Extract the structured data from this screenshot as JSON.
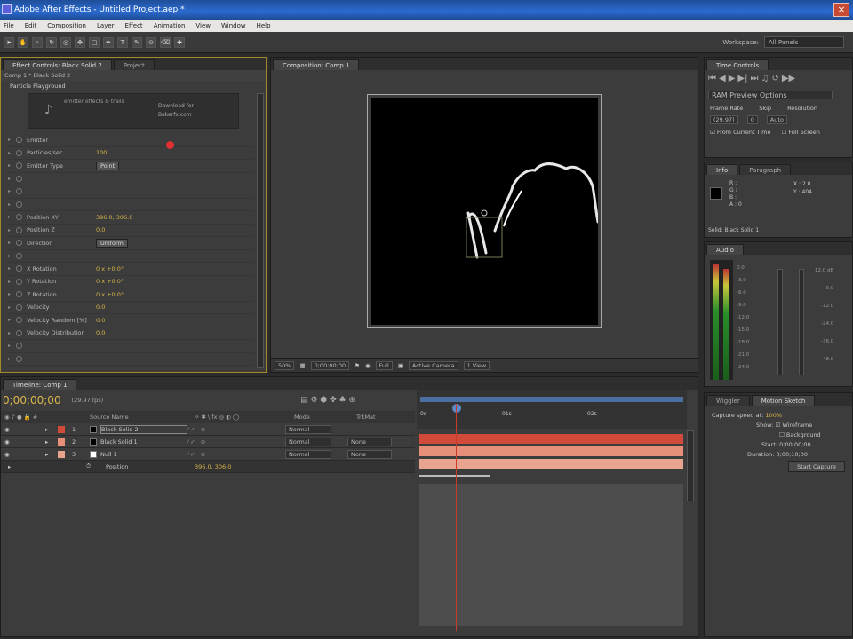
{
  "title": "Adobe After Effects - Untitled Project.aep *",
  "menu": [
    "File",
    "Edit",
    "Composition",
    "Layer",
    "Effect",
    "Animation",
    "View",
    "Window",
    "Help"
  ],
  "workspace": {
    "label": "Workspace:",
    "value": "All Panels"
  },
  "effect_panel": {
    "tabs": [
      "Effect Controls: Black Solid 2",
      "Project"
    ],
    "breadcrumb": "Comp 1 * Black Solid 2",
    "effect_name": "Particle Playground",
    "about_text": [
      "emitter effects & trails",
      "Download for",
      "Bakerfx.com"
    ],
    "rows": [
      {
        "label": "Emitter",
        "value": ""
      },
      {
        "label": "Particles/sec",
        "value": "100"
      },
      {
        "label": "Emitter Type",
        "value": "Point",
        "dropdown": true
      },
      {
        "label": "",
        "value": ""
      },
      {
        "label": "",
        "value": ""
      },
      {
        "label": "",
        "value": ""
      },
      {
        "label": "Position XY",
        "value": "396.0, 306.0"
      },
      {
        "label": "Position Z",
        "value": "0.0"
      },
      {
        "label": "Direction",
        "value": "Uniform",
        "dropdown": true
      },
      {
        "label": "",
        "value": ""
      },
      {
        "label": "X Rotation",
        "value": "0 x +0.0°"
      },
      {
        "label": "Y Rotation",
        "value": "0 x +0.0°"
      },
      {
        "label": "Z Rotation",
        "value": "0 x +0.0°"
      },
      {
        "label": "Velocity",
        "value": "0.0"
      },
      {
        "label": "Velocity Random [%]",
        "value": "0.0"
      },
      {
        "label": "Velocity Distribution",
        "value": "0.0"
      },
      {
        "label": "",
        "value": ""
      },
      {
        "label": "",
        "value": ""
      }
    ]
  },
  "comp_panel": {
    "tab": "Composition: Comp 1",
    "bottom": {
      "zoom": "50%",
      "timecode": "0;00;00;00",
      "quality": "Full",
      "camera": "Active Camera",
      "views": "1 View"
    }
  },
  "timeline": {
    "tab": "Timeline: Comp 1",
    "timecode": "0;00;00;00",
    "fps": "(29.97 fps)",
    "headers": {
      "name": "Source Name",
      "mode": "Mode",
      "trkmat": "TrkMat"
    },
    "ruler": [
      "0s",
      "01s",
      "02s"
    ],
    "layers": [
      {
        "num": "1",
        "name": "Black Solid 2",
        "mode": "Normal",
        "trkmat": "",
        "color": "#d24a3a"
      },
      {
        "num": "2",
        "name": "Black Solid 1",
        "mode": "Normal",
        "trkmat": "None",
        "color": "#e88f7a"
      },
      {
        "num": "3",
        "name": "Null 1",
        "mode": "Normal",
        "trkmat": "None",
        "color": "#e9a48f"
      }
    ],
    "sub_row": {
      "label": "Position",
      "value": "396.0, 306.0"
    }
  },
  "time_controls": {
    "tab": "Time Controls",
    "ram_preview": "RAM Preview Options",
    "labels": [
      "Frame Rate",
      "Skip",
      "Resolution"
    ],
    "values": [
      "(29.97)",
      "0",
      "Auto"
    ],
    "from_current": "From Current Time",
    "full_screen": "Full Screen"
  },
  "info_panel": {
    "tabs": [
      "Info",
      "Paragraph"
    ],
    "lines": [
      "R :",
      "G :",
      "B :",
      "A : 0"
    ],
    "xy": [
      "X : 2.0",
      "Y : 404"
    ],
    "footer": "Solid: Black Solid 1"
  },
  "audio_panel": {
    "tab": "Audio",
    "db_left": [
      "0.0",
      "-3.0",
      "-6.0",
      "-9.0",
      "-12.0",
      "-15.0",
      "-18.0",
      "-21.0",
      "-24.0"
    ],
    "db_right": [
      "12.0 dB",
      "0.0",
      "-12.0",
      "-24.0",
      "-36.0",
      "-48.0"
    ]
  },
  "motion_sketch": {
    "tabs": [
      "Wiggler",
      "Motion Sketch"
    ],
    "capture_speed": "Capture speed at:",
    "capture_value": "100%",
    "show_label": "Show:",
    "wireframe": "Wireframe",
    "background": "Background",
    "start_label": "Start:",
    "start_value": "0;00;00;00",
    "duration_label": "Duration:",
    "duration_value": "0;00;10;00",
    "button": "Start Capture"
  }
}
